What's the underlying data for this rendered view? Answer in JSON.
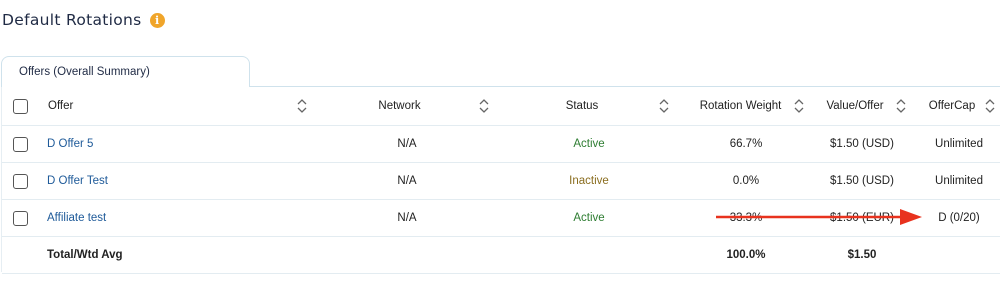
{
  "page": {
    "title": "Default Rotations",
    "info_icon": "info-icon"
  },
  "tab": {
    "label": "Offers (Overall Summary)"
  },
  "table": {
    "columns": [
      "Offer",
      "Network",
      "Status",
      "Rotation Weight",
      "Value/Offer",
      "OfferCap"
    ],
    "rows": [
      {
        "offer": "D Offer 5",
        "network": "N/A",
        "status": "Active",
        "weight": "66.7%",
        "value": "$1.50 (USD)",
        "cap": "Unlimited"
      },
      {
        "offer": "D Offer Test",
        "network": "N/A",
        "status": "Inactive",
        "weight": "0.0%",
        "value": "$1.50 (USD)",
        "cap": "Unlimited"
      },
      {
        "offer": "Affiliate test",
        "network": "N/A",
        "status": "Active",
        "weight": "33.3%",
        "value": "$1.50 (EUR)",
        "cap": "D (0/20)"
      }
    ],
    "total": {
      "label": "Total/Wtd Avg",
      "weight": "100.0%",
      "value": "$1.50"
    }
  },
  "colors": {
    "active": "#2e7d32",
    "inactive": "#8a6d1f",
    "link": "#1e5a99",
    "annotation_arrow": "#e8321e",
    "info_icon": "#f0a52a"
  }
}
